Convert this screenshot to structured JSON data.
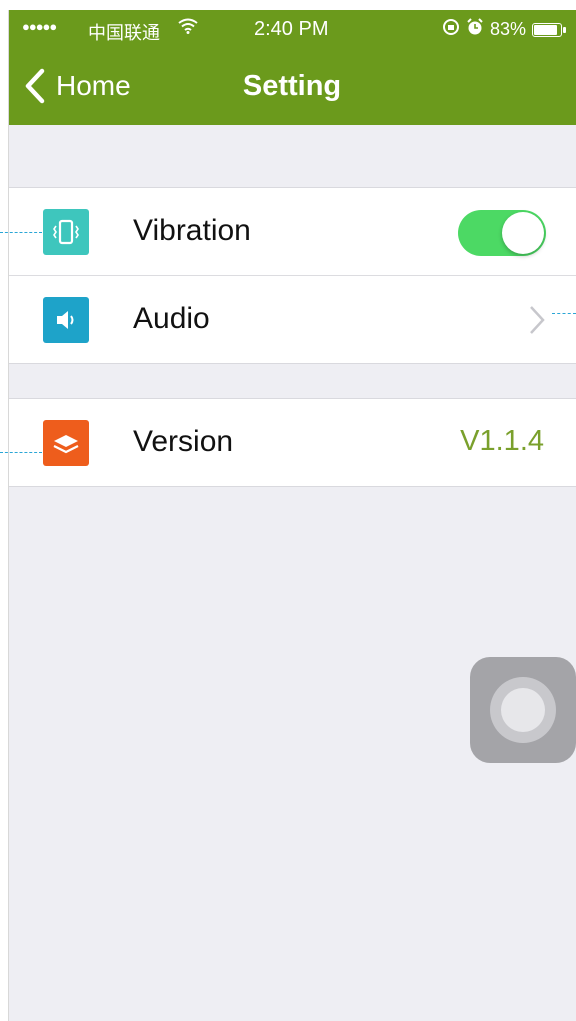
{
  "status_bar": {
    "signal": "●●●●●",
    "carrier": "中国联通",
    "wifi": "wifi-icon",
    "time": "2:40 PM",
    "battery_percent": "83%",
    "battery_level": 0.83
  },
  "nav": {
    "back_label": "Home",
    "title": "Setting"
  },
  "settings": {
    "vibration": {
      "label": "Vibration",
      "icon": "vibration-icon",
      "enabled": true
    },
    "audio": {
      "label": "Audio",
      "icon": "speaker-icon"
    },
    "version": {
      "label": "Version",
      "icon": "layers-icon",
      "value": "V1.1.4"
    }
  },
  "colors": {
    "header": "#6b9a1c",
    "toggle_on": "#4cd964",
    "version_value": "#7aa02c",
    "vibration_icon": "#3ec6bd",
    "audio_icon": "#1ea3c9",
    "version_icon": "#ee5d1c"
  }
}
